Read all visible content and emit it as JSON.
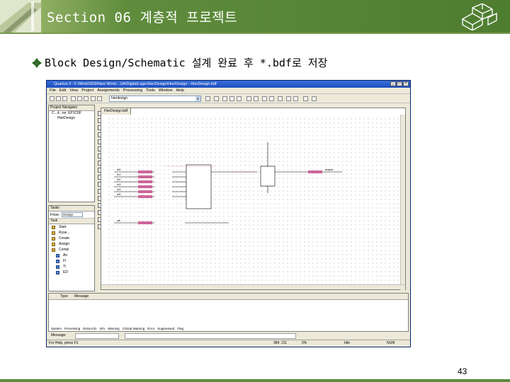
{
  "slide": {
    "title": "Section 06 계층적 프로젝트",
    "bullet_text": "Block Design/Schematic 설계 완료 후 *.bdf로 저장",
    "page_number": "43"
  },
  "window": {
    "title": "Quartus II - F:/Work2009/New Work/...UA/DigitalLogic/HierDesign/HierDesign - HierDesign.bdf",
    "controls": [
      "_",
      "□",
      "×"
    ],
    "menu": [
      "File",
      "Edit",
      "View",
      "Project",
      "Assignments",
      "Processing",
      "Tools",
      "Window",
      "Help"
    ],
    "toolbar_combo": "hierdesign"
  },
  "project_navigator": {
    "header": "Project Navigator",
    "tree": [
      "C...d...ne: EP1C6F",
      "HierDesign"
    ]
  },
  "tasks": {
    "header": "Tasks",
    "flow_label": "Flow:",
    "flow_value": "Design",
    "list_header": "Task",
    "items": [
      "Start",
      "Ryse...",
      "Create",
      "Assign",
      "Compi",
      "An",
      "Fi",
      "Ti",
      "ED"
    ]
  },
  "document": {
    "tab": "HierDesign.bdf"
  },
  "schematic": {
    "inputs": [
      "in0",
      "in1",
      "in2",
      "in3",
      "in4",
      "in5"
    ],
    "in_clk": "clk",
    "output": "output"
  },
  "messages": {
    "col_type": "Type",
    "col_message": "Message",
    "tabs": [
      "System",
      "Processing",
      "Extra Info",
      "Info",
      "Warning",
      "Critical Warning",
      "Error",
      "Suppressed",
      "Flag"
    ],
    "row_label": "Message:",
    "location_label": "Location:"
  },
  "statusbar": {
    "help": "For Help, press F1",
    "coords": "384, 211",
    "zoom": "0%",
    "state": "Idle",
    "num": "NUM"
  }
}
